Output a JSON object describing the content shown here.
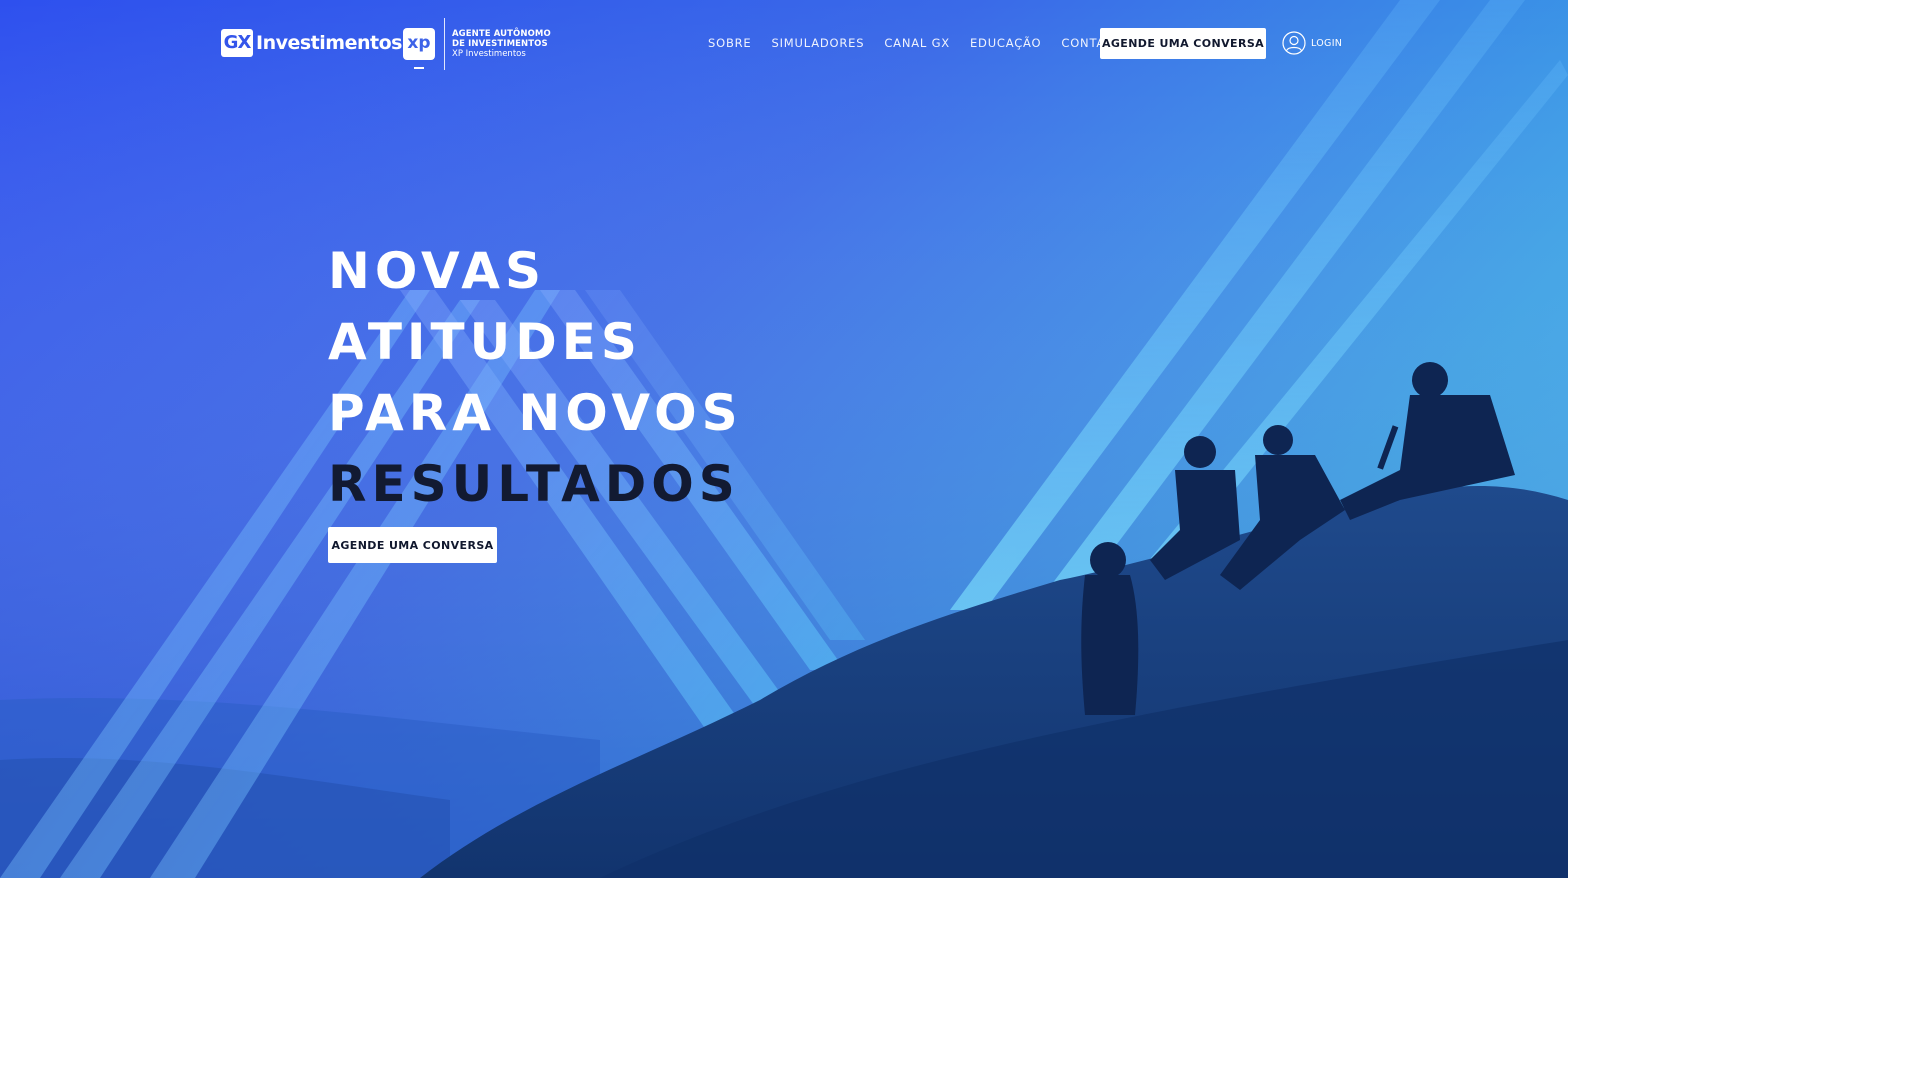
{
  "brand": {
    "gx_mark": "GX",
    "gx_word": "Investimentos",
    "xp_mark": "xp",
    "xp_line1": "AGENTE AUTÔNOMO",
    "xp_line2": "DE INVESTIMENTOS",
    "xp_line3": "XP Investimentos"
  },
  "nav": {
    "items": [
      {
        "label": "SOBRE"
      },
      {
        "label": "SIMULADORES"
      },
      {
        "label": "CANAL GX"
      },
      {
        "label": "EDUCAÇÃO"
      },
      {
        "label": "CONTATO"
      }
    ],
    "cta_label": "AGENDE UMA CONVERSA",
    "login_label": "LOGIN"
  },
  "hero": {
    "line1": "NOVAS",
    "line2": "ATITUDES",
    "line3": "PARA NOVOS",
    "line4": "RESULTADOS",
    "cta_label": "AGENDE UMA CONVERSA"
  },
  "colors": {
    "bg_start": "#2e50ee",
    "bg_end": "#46b8ef",
    "accent_dark": "#121a32",
    "white": "#ffffff"
  },
  "icons": {
    "user": "user-icon"
  }
}
